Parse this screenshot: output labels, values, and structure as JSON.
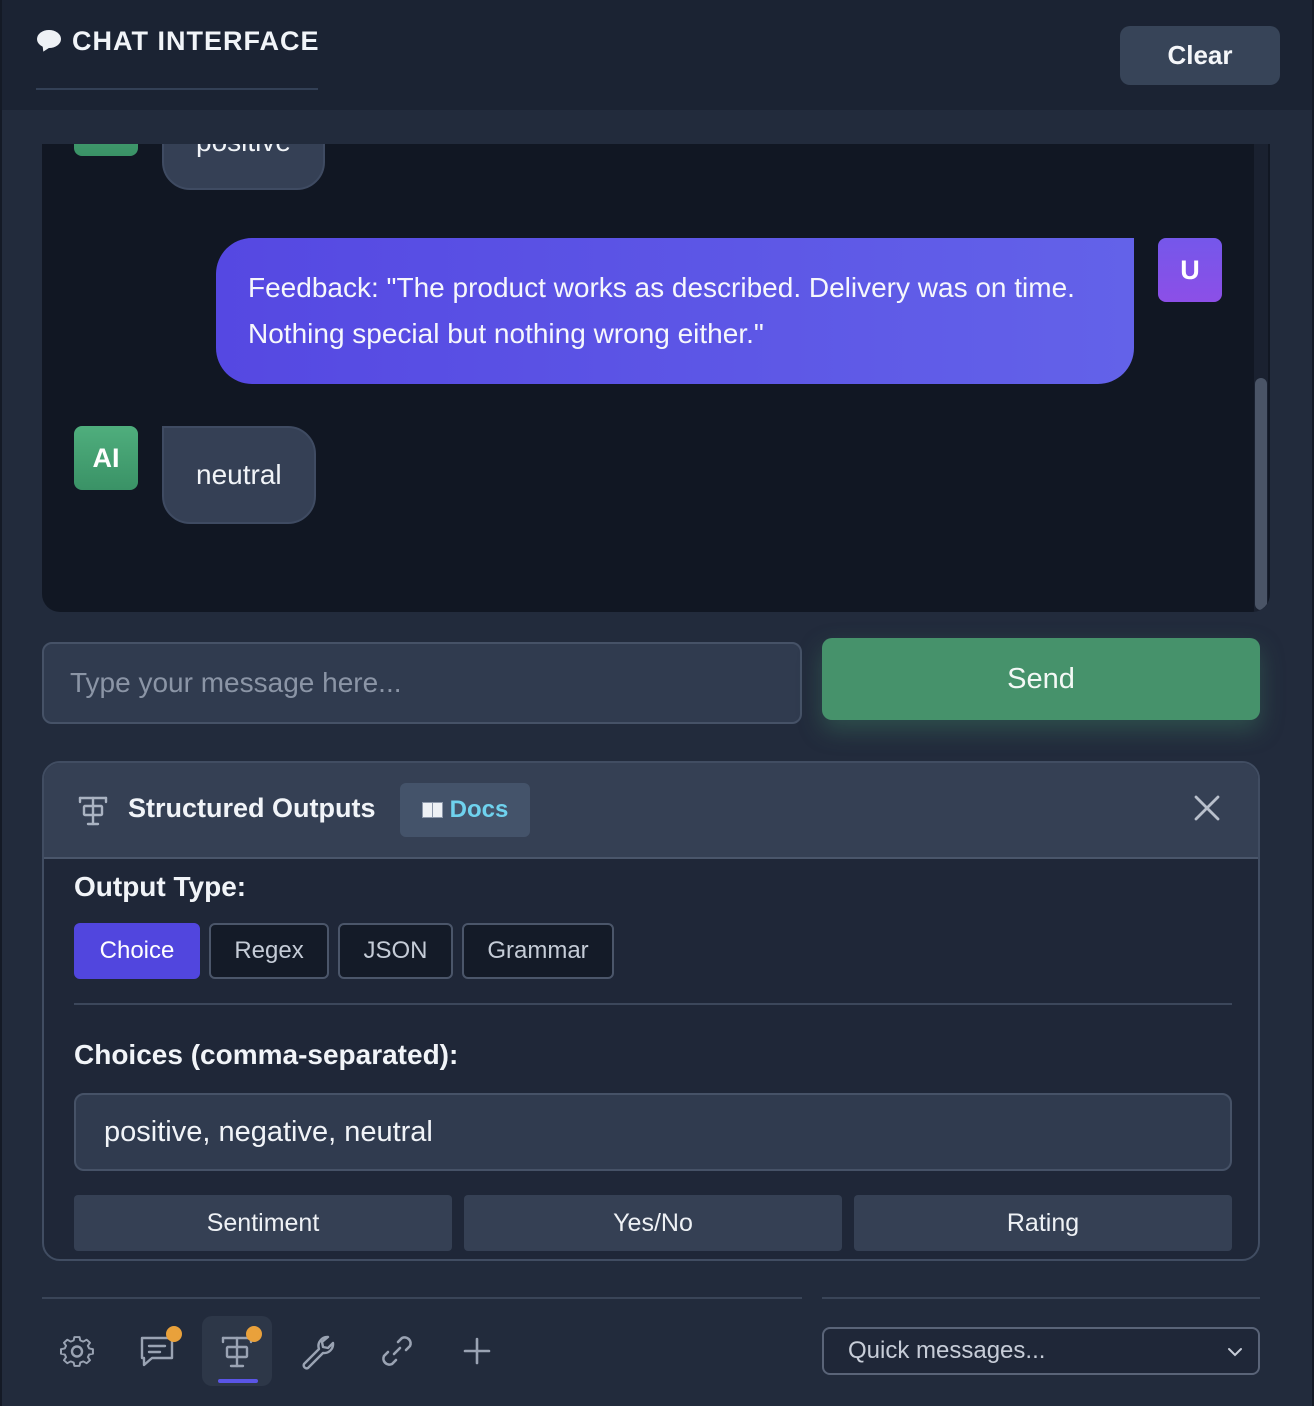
{
  "header": {
    "title": "CHAT INTERFACE",
    "clear_label": "Clear"
  },
  "chat": {
    "messages": [
      {
        "role": "ai",
        "avatar": "AI",
        "text": "positive"
      },
      {
        "role": "user",
        "avatar": "U",
        "text": "Feedback: \"The product works as described. Delivery was on time. Nothing special but nothing wrong either.\""
      },
      {
        "role": "ai",
        "avatar": "AI",
        "text": "neutral"
      }
    ]
  },
  "composer": {
    "placeholder": "Type your message here...",
    "value": "",
    "send_label": "Send"
  },
  "structured_outputs": {
    "title": "Structured Outputs",
    "docs_label": "Docs",
    "output_type_label": "Output Type:",
    "types": [
      "Choice",
      "Regex",
      "JSON",
      "Grammar"
    ],
    "active_type": "Choice",
    "choices_label": "Choices (comma-separated):",
    "choices_value": "positive, negative, neutral",
    "presets": [
      "Sentiment",
      "Yes/No",
      "Rating"
    ]
  },
  "toolbar": {
    "tools": [
      "gear-icon",
      "chat-icon",
      "structured-output-icon",
      "wrench-icon",
      "link-icon",
      "plus-icon"
    ],
    "active_tool": "structured-output-icon",
    "quick_messages_placeholder": "Quick messages..."
  },
  "colors": {
    "accent": "#5146de",
    "send": "#46926b",
    "ai_avatar": "#4fae7d",
    "user_bubble": "#5548e2",
    "notification_dot": "#e9a13b"
  }
}
